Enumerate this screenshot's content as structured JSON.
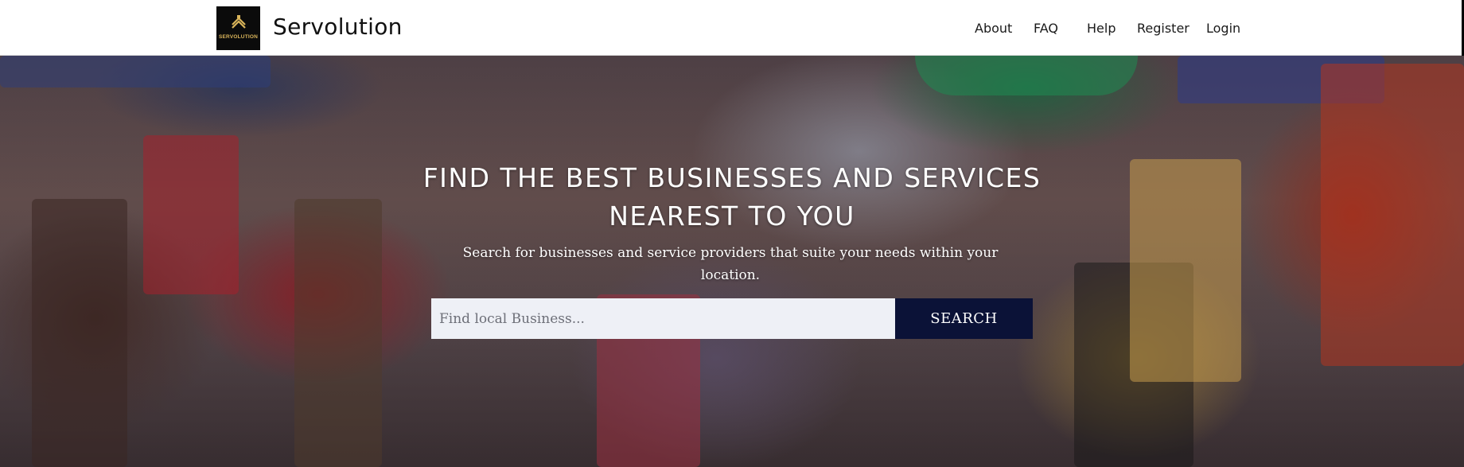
{
  "header": {
    "logo_text": "SERVOLUTION",
    "brand_name": "Servolution",
    "nav": [
      {
        "label": "About"
      },
      {
        "label": "FAQ"
      },
      {
        "label": "Help"
      },
      {
        "label": "Register"
      },
      {
        "label": "Login"
      }
    ]
  },
  "hero": {
    "title_line1": "FIND THE BEST BUSINESSES AND SERVICES",
    "title_line2": "NEAREST TO YOU",
    "subtitle_line1": "Search for businesses and service providers that suite your needs within your",
    "subtitle_line2": "location.",
    "search": {
      "placeholder": "Find local Business...",
      "button_label": "SEARCH"
    }
  },
  "colors": {
    "button_bg": "#0b1237",
    "input_bg": "#eef0f6",
    "logo_gold": "#d9b45a"
  },
  "icons": {
    "logo": "servolution-logo-icon"
  }
}
